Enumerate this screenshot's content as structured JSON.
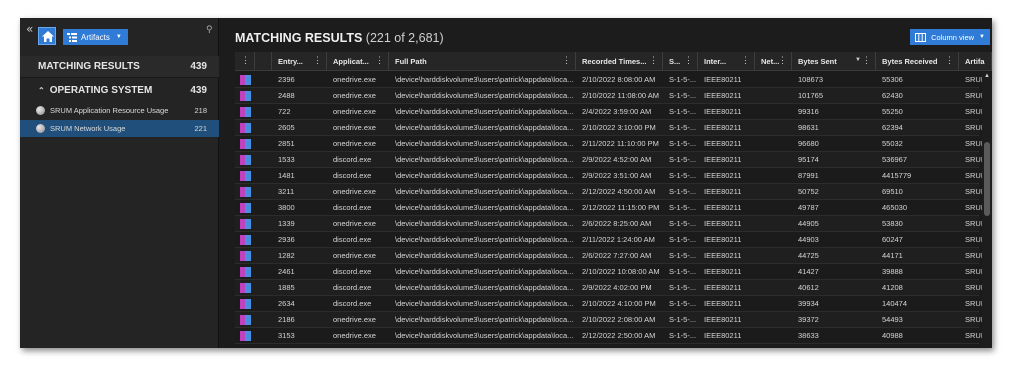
{
  "sidebar": {
    "artifacts_label": "Artifacts",
    "matching_results": {
      "label": "MATCHING RESULTS",
      "count": "439"
    },
    "operating_system": {
      "label": "OPERATING SYSTEM",
      "count": "439"
    },
    "items": [
      {
        "label": "SRUM Application Resource Usage",
        "count": "218",
        "selected": false
      },
      {
        "label": "SRUM Network Usage",
        "count": "221",
        "selected": true
      }
    ]
  },
  "header": {
    "title": "MATCHING RESULTS",
    "count": "(221 of 2,681)",
    "column_view_label": "Column view"
  },
  "columns": [
    {
      "key": "tag",
      "label": ""
    },
    {
      "key": "flag",
      "label": ""
    },
    {
      "key": "entry",
      "label": "Entry..."
    },
    {
      "key": "app",
      "label": "Applicat..."
    },
    {
      "key": "path",
      "label": "Full Path"
    },
    {
      "key": "time",
      "label": "Recorded Times..."
    },
    {
      "key": "sid",
      "label": "S..."
    },
    {
      "key": "iface",
      "label": "Inter..."
    },
    {
      "key": "net",
      "label": "Net..."
    },
    {
      "key": "sent",
      "label": "Bytes Sent"
    },
    {
      "key": "recv",
      "label": "Bytes Received"
    },
    {
      "key": "artifact",
      "label": "Artifa"
    }
  ],
  "rows": [
    {
      "entry": "2396",
      "app": "onedrive.exe",
      "path": "\\device\\harddiskvolume3\\users\\patrick\\appdata\\loca...",
      "time": "2/10/2022 8:08:00 AM",
      "sid": "S-1-5-...",
      "iface": "IEEE80211",
      "net": "",
      "sent": "108673",
      "recv": "55306",
      "artifact": "SRUM"
    },
    {
      "entry": "2488",
      "app": "onedrive.exe",
      "path": "\\device\\harddiskvolume3\\users\\patrick\\appdata\\loca...",
      "time": "2/10/2022 11:08:00 AM",
      "sid": "S-1-5-...",
      "iface": "IEEE80211",
      "net": "",
      "sent": "101765",
      "recv": "62430",
      "artifact": "SRUM"
    },
    {
      "entry": "722",
      "app": "onedrive.exe",
      "path": "\\device\\harddiskvolume3\\users\\patrick\\appdata\\loca...",
      "time": "2/4/2022 3:59:00 AM",
      "sid": "S-1-5-...",
      "iface": "IEEE80211",
      "net": "",
      "sent": "99316",
      "recv": "55250",
      "artifact": "SRUM"
    },
    {
      "entry": "2605",
      "app": "onedrive.exe",
      "path": "\\device\\harddiskvolume3\\users\\patrick\\appdata\\loca...",
      "time": "2/10/2022 3:10:00 PM",
      "sid": "S-1-5-...",
      "iface": "IEEE80211",
      "net": "",
      "sent": "98631",
      "recv": "62394",
      "artifact": "SRUM"
    },
    {
      "entry": "2851",
      "app": "onedrive.exe",
      "path": "\\device\\harddiskvolume3\\users\\patrick\\appdata\\loca...",
      "time": "2/11/2022 11:10:00 PM",
      "sid": "S-1-5-...",
      "iface": "IEEE80211",
      "net": "",
      "sent": "96680",
      "recv": "55032",
      "artifact": "SRUM"
    },
    {
      "entry": "1533",
      "app": "discord.exe",
      "path": "\\device\\harddiskvolume3\\users\\patrick\\appdata\\loca...",
      "time": "2/9/2022 4:52:00 AM",
      "sid": "S-1-5-...",
      "iface": "IEEE80211",
      "net": "",
      "sent": "95174",
      "recv": "536967",
      "artifact": "SRUM"
    },
    {
      "entry": "1481",
      "app": "discord.exe",
      "path": "\\device\\harddiskvolume3\\users\\patrick\\appdata\\loca...",
      "time": "2/9/2022 3:51:00 AM",
      "sid": "S-1-5-...",
      "iface": "IEEE80211",
      "net": "",
      "sent": "87991",
      "recv": "4415779",
      "artifact": "SRUM"
    },
    {
      "entry": "3211",
      "app": "onedrive.exe",
      "path": "\\device\\harddiskvolume3\\users\\patrick\\appdata\\loca...",
      "time": "2/12/2022 4:50:00 AM",
      "sid": "S-1-5-...",
      "iface": "IEEE80211",
      "net": "",
      "sent": "50752",
      "recv": "69510",
      "artifact": "SRUM"
    },
    {
      "entry": "3800",
      "app": "discord.exe",
      "path": "\\device\\harddiskvolume3\\users\\patrick\\appdata\\loca...",
      "time": "2/12/2022 11:15:00 PM",
      "sid": "S-1-5-...",
      "iface": "IEEE80211",
      "net": "",
      "sent": "49787",
      "recv": "465030",
      "artifact": "SRUM"
    },
    {
      "entry": "1339",
      "app": "onedrive.exe",
      "path": "\\device\\harddiskvolume3\\users\\patrick\\appdata\\loca...",
      "time": "2/6/2022 8:25:00 AM",
      "sid": "S-1-5-...",
      "iface": "IEEE80211",
      "net": "",
      "sent": "44905",
      "recv": "53830",
      "artifact": "SRUM"
    },
    {
      "entry": "2936",
      "app": "discord.exe",
      "path": "\\device\\harddiskvolume3\\users\\patrick\\appdata\\loca...",
      "time": "2/11/2022 1:24:00 AM",
      "sid": "S-1-5-...",
      "iface": "IEEE80211",
      "net": "",
      "sent": "44903",
      "recv": "60247",
      "artifact": "SRUM"
    },
    {
      "entry": "1282",
      "app": "onedrive.exe",
      "path": "\\device\\harddiskvolume3\\users\\patrick\\appdata\\loca...",
      "time": "2/6/2022 7:27:00 AM",
      "sid": "S-1-5-...",
      "iface": "IEEE80211",
      "net": "",
      "sent": "44725",
      "recv": "44171",
      "artifact": "SRUM"
    },
    {
      "entry": "2461",
      "app": "discord.exe",
      "path": "\\device\\harddiskvolume3\\users\\patrick\\appdata\\loca...",
      "time": "2/10/2022 10:08:00 AM",
      "sid": "S-1-5-...",
      "iface": "IEEE80211",
      "net": "",
      "sent": "41427",
      "recv": "39888",
      "artifact": "SRUM"
    },
    {
      "entry": "1885",
      "app": "discord.exe",
      "path": "\\device\\harddiskvolume3\\users\\patrick\\appdata\\loca...",
      "time": "2/9/2022 4:02:00 PM",
      "sid": "S-1-5-...",
      "iface": "IEEE80211",
      "net": "",
      "sent": "40612",
      "recv": "41208",
      "artifact": "SRUM"
    },
    {
      "entry": "2634",
      "app": "discord.exe",
      "path": "\\device\\harddiskvolume3\\users\\patrick\\appdata\\loca...",
      "time": "2/10/2022 4:10:00 PM",
      "sid": "S-1-5-...",
      "iface": "IEEE80211",
      "net": "",
      "sent": "39934",
      "recv": "140474",
      "artifact": "SRUM"
    },
    {
      "entry": "2186",
      "app": "onedrive.exe",
      "path": "\\device\\harddiskvolume3\\users\\patrick\\appdata\\loca...",
      "time": "2/10/2022 2:08:00 AM",
      "sid": "S-1-5-...",
      "iface": "IEEE80211",
      "net": "",
      "sent": "39372",
      "recv": "54493",
      "artifact": "SRUM"
    },
    {
      "entry": "3153",
      "app": "onedrive.exe",
      "path": "\\device\\harddiskvolume3\\users\\patrick\\appdata\\loca...",
      "time": "2/12/2022 2:50:00 AM",
      "sid": "S-1-5-...",
      "iface": "IEEE80211",
      "net": "",
      "sent": "38633",
      "recv": "40988",
      "artifact": "SRUM"
    }
  ],
  "colors": {
    "accent": "#2f7bd6",
    "selected_row": "#1f4f7a",
    "tag_magenta": "#c040c0",
    "tag_blue": "#4a8ee0"
  },
  "icons": {
    "collapse": "double-chevron-left-icon",
    "home": "home-icon",
    "artifacts": "tree-list-icon",
    "pin": "pin-icon",
    "column_view": "columns-icon",
    "column_menu": "kebab-menu-icon",
    "artifact_source": "database-icon"
  }
}
